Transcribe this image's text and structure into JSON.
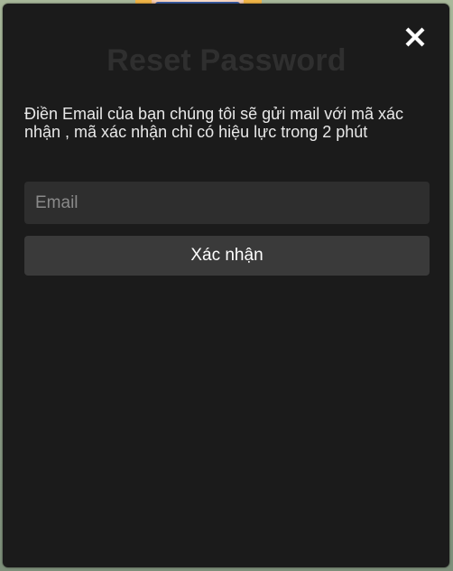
{
  "background": {
    "art": "anime-character-illustration"
  },
  "modal": {
    "title": "Reset Password",
    "close_icon": "close-icon",
    "description": "Điền Email của bạn chúng tôi sẽ gửi mail với mã xác nhận , mã xác nhận chỉ có hiệu lực trong 2 phút",
    "email": {
      "value": "",
      "placeholder": "Email"
    },
    "submit_label": "Xác nhận"
  },
  "colors": {
    "modal_bg": "#1b1b1b",
    "input_bg": "#2e2e2e",
    "button_bg": "#3a3a3a",
    "title_color": "#2f2f2f",
    "text_color": "#e8e8e8"
  }
}
